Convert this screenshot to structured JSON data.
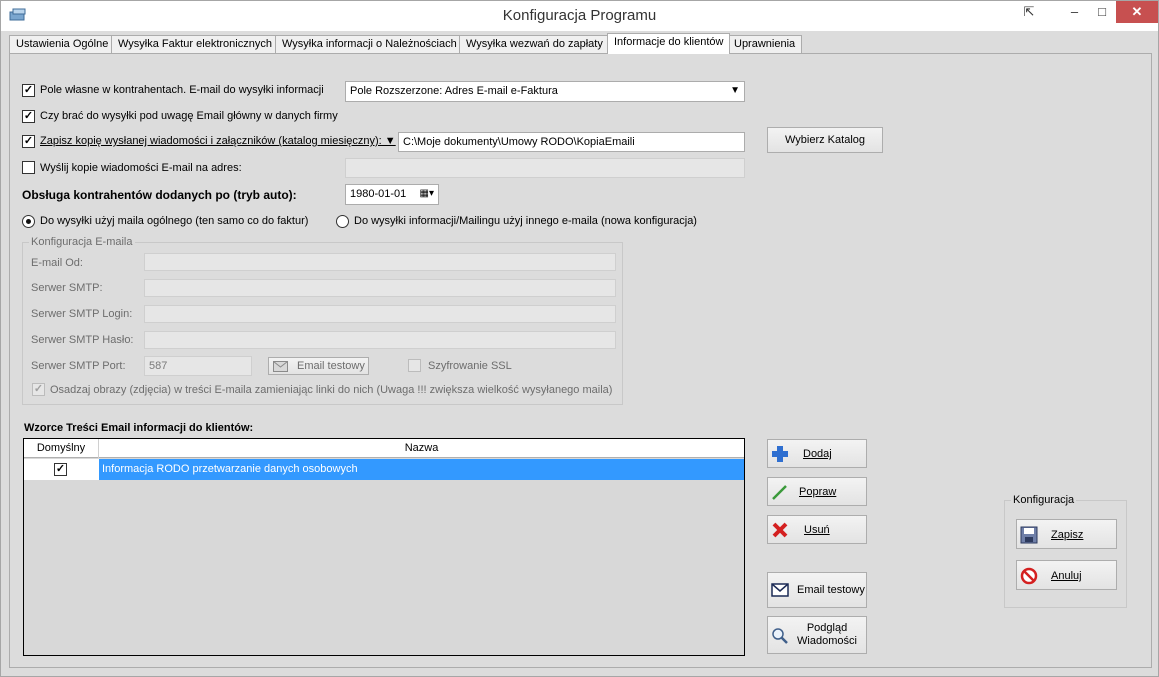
{
  "window": {
    "title": "Konfiguracja Programu",
    "controls": {
      "minimize": "–",
      "maximize": "□",
      "close": "✕",
      "extra": "⇱"
    }
  },
  "tabs": [
    {
      "label": "Ustawienia Ogólne"
    },
    {
      "label": "Wysyłka Faktur elektronicznych"
    },
    {
      "label": "Wysyłka informacji o Należnościach"
    },
    {
      "label": "Wysyłka wezwań do zapłaty"
    },
    {
      "label": "Informacje do klientów"
    },
    {
      "label": "Uprawnienia"
    }
  ],
  "active_tab": "Informacje do klientów",
  "options": {
    "custom_field": {
      "label": "Pole własne w kontrahentach. E-mail do wysyłki informacji",
      "checked": true
    },
    "custom_field_select": {
      "value": "Pole Rozszerzone: Adres E-mail e-Faktura"
    },
    "main_email": {
      "label": "Czy brać do wysyłki pod uwagę Email główny w danych firmy",
      "checked": true
    },
    "save_copy": {
      "label": "Zapisz kopię wysłanej wiadomości i załączników (katalog miesięczny): ▼",
      "checked": true
    },
    "save_copy_path": {
      "value": "C:\\Moje dokumenty\\Umowy RODO\\KopiaEmaili"
    },
    "choose_dir_button": "Wybierz Katalog",
    "send_copy": {
      "label": "Wyślij kopie wiadomości E-mail na adres:",
      "checked": false
    },
    "send_copy_value": "",
    "auto_mode_label": "Obsługa kontrahentów dodanych po (tryb auto):",
    "auto_mode_date": "1980-01-01",
    "radio_general": {
      "label": "Do wysyłki użyj maila ogólnego (ten samo co do faktur)",
      "selected": true
    },
    "radio_other": {
      "label": "Do wysyłki informacji/Mailingu użyj innego e-maila (nowa konfiguracja)",
      "selected": false
    }
  },
  "email_config": {
    "group_title": "Konfiguracja E-maila",
    "email_from_label": "E-mail Od:",
    "email_from_value": "",
    "smtp_server_label": "Serwer SMTP:",
    "smtp_server_value": "",
    "smtp_login_label": "Serwer SMTP Login:",
    "smtp_login_value": "",
    "smtp_password_label": "Serwer SMTP Hasło:",
    "smtp_password_value": "",
    "smtp_port_label": "Serwer SMTP Port:",
    "smtp_port_value": "587",
    "test_email_button": "Email testowy",
    "ssl_label": "Szyfrowanie SSL",
    "ssl_checked": false,
    "embed_images_label": "Osadzaj obrazy (zdjęcia) w treści E-maila zamieniając linki do nich (Uwaga !!! zwiększa wielkość wysyłanego maila)",
    "embed_images_checked": true
  },
  "templates": {
    "heading": "Wzorce Treści Email informacji do klientów:",
    "columns": [
      "Domyślny",
      "Nazwa"
    ],
    "rows": [
      {
        "default": true,
        "name": "Informacja RODO przetwarzanie danych osobowych",
        "selected": true
      }
    ]
  },
  "actions": {
    "add": {
      "label": "Dodaj",
      "icon": "plus-icon"
    },
    "edit": {
      "label": "Popraw",
      "icon": "pencil-icon"
    },
    "delete": {
      "label": "Usuń",
      "icon": "delete-x-icon"
    },
    "test_email": {
      "label": "Email testowy",
      "icon": "envelope-icon"
    },
    "preview": {
      "label": "Podgląd\nWiadomości",
      "label_line1": "Podgląd",
      "label_line2": "Wiadomości",
      "icon": "magnifier-icon"
    }
  },
  "config_group": {
    "title": "Konfiguracja",
    "save": {
      "label": "Zapisz",
      "icon": "floppy-icon"
    },
    "cancel": {
      "label": "Anuluj",
      "icon": "stop-icon"
    }
  },
  "colors": {
    "selection": "#3399ff",
    "panel": "#dcdcdc"
  }
}
